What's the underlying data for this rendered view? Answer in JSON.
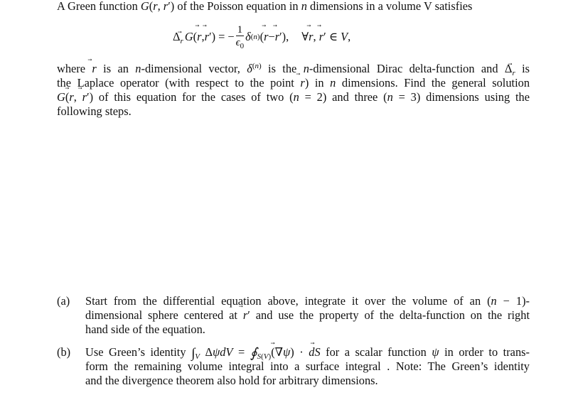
{
  "intro": {
    "line1_prefix": "A Green function ",
    "line1_func": "G",
    "line1_args": "(r, r′)",
    "line1_suffix": " of the Poisson equation in ",
    "line1_n": "n",
    "line1_end": " dimensions in a volume V satisfies"
  },
  "equation": {
    "operator": "Δ",
    "operator_sub": "r",
    "lhs": "G(r, r′)",
    "equals": "= −",
    "frac_num": "1",
    "frac_den": "ϵ0",
    "delta": "δ",
    "delta_sup": "(n)",
    "delta_arg": "(r − r′),",
    "condition": "∀r, r′ ∈ V,"
  },
  "paragraph": {
    "lines": [
      "where r is an n-dimensional vector, δ(n) is the n-dimensional Dirac delta-function and Δr is",
      "the Laplace operator (with respect to the point r) in n dimensions. Find the general solution",
      "G(r, r′) of this equation for the cases of two (n = 2) and three (n = 3) dimensions using the",
      "following steps."
    ]
  },
  "items": [
    {
      "label": "(a)",
      "lines": [
        "Start from the differential equation above, integrate it over the volume of an (n − 1)-",
        "dimensional sphere centered at r′ and use the property of the delta-function on the right",
        "hand side of the equation."
      ]
    },
    {
      "label": "(b)",
      "lines": [
        "Use Green’s identity ∫V ΔψdV = ∮S(V)(∇ψ) · dS for a scalar function ψ in order to trans-",
        "form the remaining volume integral into a surface integral . Note: The Green’s identity",
        "and the divergence theorem also hold for arbitrary dimensions."
      ]
    }
  ]
}
